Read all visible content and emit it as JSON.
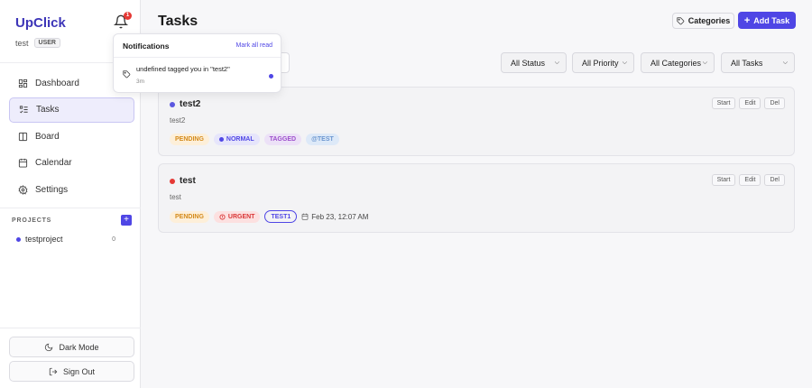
{
  "app": {
    "brand": "UpClick",
    "bell_count": "1",
    "username": "test",
    "role": "USER"
  },
  "nav": [
    {
      "label": "Dashboard",
      "icon": "dashboard-icon",
      "active": false
    },
    {
      "label": "Tasks",
      "icon": "tasks-icon",
      "active": true
    },
    {
      "label": "Board",
      "icon": "board-icon",
      "active": false
    },
    {
      "label": "Calendar",
      "icon": "calendar-icon",
      "active": false
    },
    {
      "label": "Settings",
      "icon": "settings-icon",
      "active": false
    }
  ],
  "projects": {
    "label": "PROJECTS",
    "items": [
      {
        "name": "testproject",
        "count": "0"
      }
    ]
  },
  "footer": {
    "dark_mode": "Dark Mode",
    "sign_out": "Sign Out"
  },
  "header": {
    "title": "Tasks",
    "categories_btn": "Categories",
    "add_task_btn": "Add Task"
  },
  "filters": {
    "status": "All Status",
    "priority": "All Priority",
    "categories": "All Categories",
    "tasks": "All Tasks"
  },
  "tasks": [
    {
      "title": "test2",
      "description": "test2",
      "dot_color": "#5b57e0",
      "actions": [
        "Start",
        "Edit",
        "Del"
      ],
      "status": "PENDING",
      "priority": "NORMAL",
      "tag": "TAGGED",
      "mention": "@TEST"
    },
    {
      "title": "test",
      "description": "test",
      "dot_color": "#e53935",
      "actions": [
        "Start",
        "Edit",
        "Del"
      ],
      "status": "PENDING",
      "priority": "URGENT",
      "project": "TEST1",
      "date": "Feb 23, 12:07 AM"
    }
  ],
  "notifications": {
    "title": "Notifications",
    "mark_all": "Mark all read",
    "items": [
      {
        "text": "undefined tagged you in \"test2\"",
        "time": "3m",
        "unread": true
      }
    ]
  },
  "colors": {
    "accent": "#4f46e5",
    "brand": "#3d35b8",
    "danger": "#e53935"
  }
}
